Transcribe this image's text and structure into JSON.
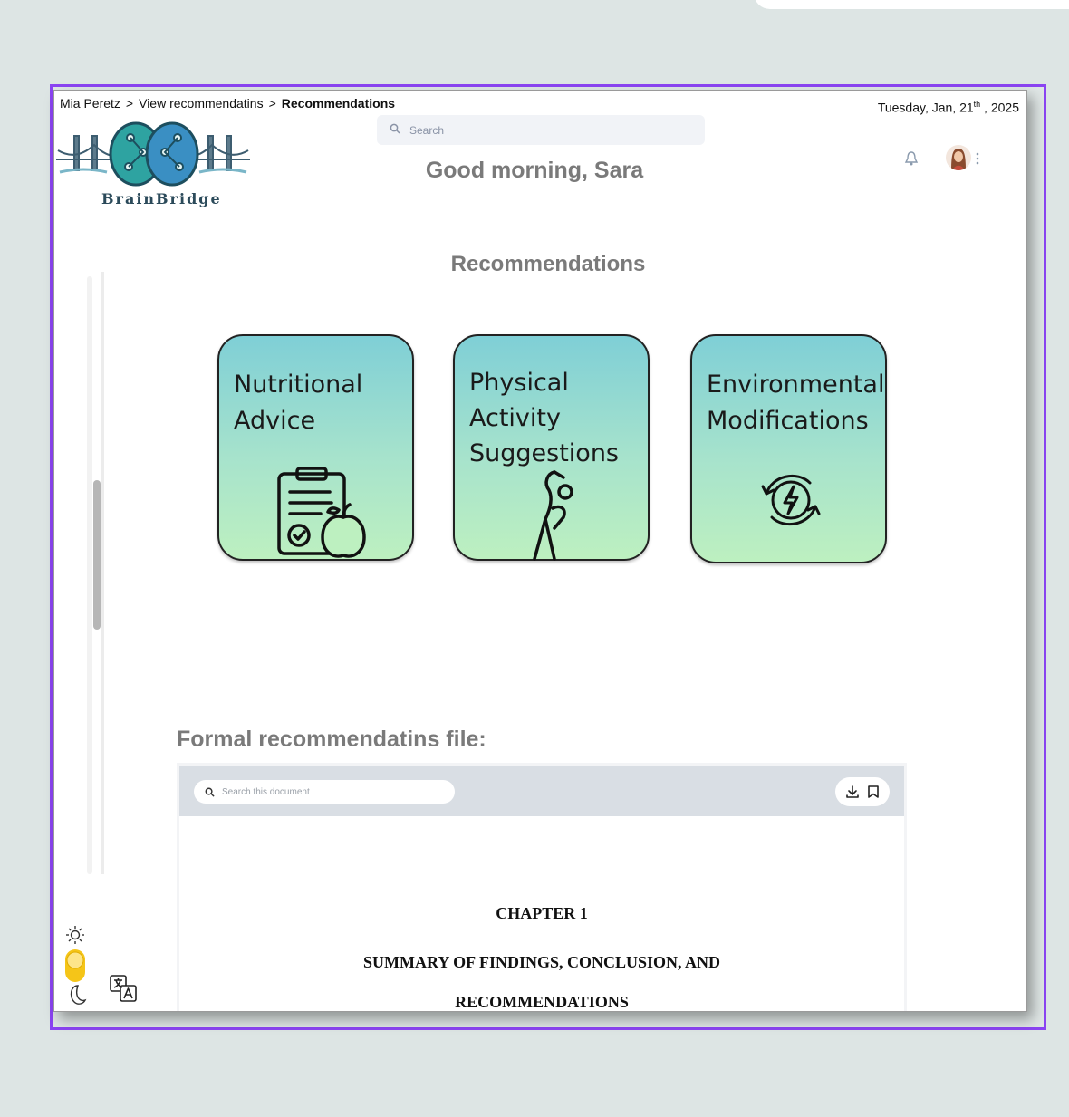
{
  "breadcrumb": {
    "items": [
      "Mia Peretz",
      "View recommendatins",
      "Recommendations"
    ],
    "separator": ">"
  },
  "date": {
    "prefix": "Tuesday,  Jan, 21",
    "suffix_sup": "th",
    "year": " , 2025"
  },
  "logo": {
    "text": "BrainBridge",
    "icon": "brain-bridge-logo"
  },
  "search": {
    "placeholder": "Search",
    "icon": "search-icon"
  },
  "greeting": "Good morning, Sara",
  "header_icons": [
    "bell-icon",
    "avatar",
    "kebab-menu-icon"
  ],
  "section_title": "Recommendations",
  "cards": [
    {
      "label": "Nutritional\nAdvice",
      "icon": "clipboard-apple-icon"
    },
    {
      "label": "Physical\nActivity\nSuggestions",
      "icon": "stretching-person-icon"
    },
    {
      "label": "Environmental\nModifications",
      "icon": "energy-recycle-icon"
    }
  ],
  "file_section": {
    "title": "Formal recommendatins file:",
    "search_placeholder": "Search this document",
    "actions": [
      "download-icon",
      "bookmark-icon"
    ],
    "page": {
      "chapter": "CHAPTER 1",
      "heading_line1": "SUMMARY OF FINDINGS, CONCLUSION, AND",
      "heading_line2": "RECOMMENDATIONS"
    }
  },
  "colors": {
    "frame_border": "#8b44f2",
    "card_gradient_top": "#7fcfd6",
    "card_gradient_bottom": "#bdf0c0",
    "toggle_accent": "#f5c518"
  },
  "theme_toggle": {
    "icons": [
      "sun-icon",
      "moon-icon"
    ],
    "state": "light"
  },
  "language_icon": "translate-icon"
}
